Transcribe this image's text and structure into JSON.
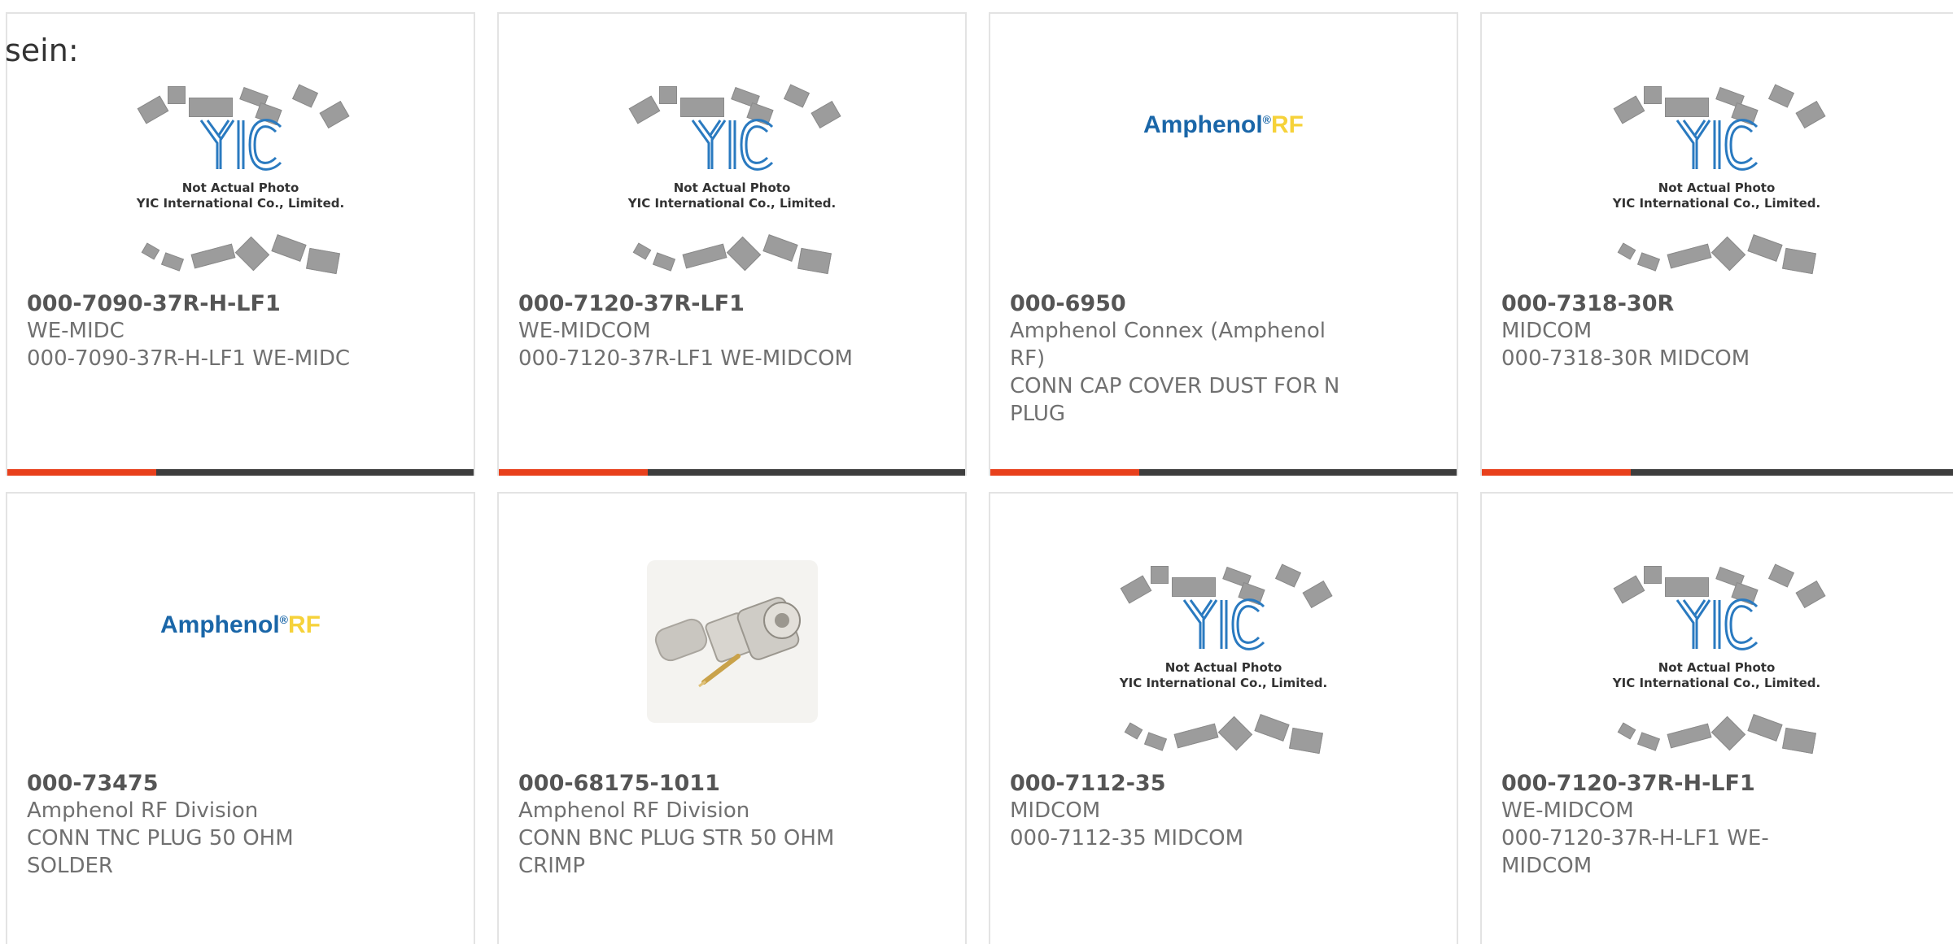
{
  "stray_text": "sein:",
  "placeholder": {
    "logo_text": "YIC",
    "caption_line1": "Not Actual Photo",
    "caption_line2": "YIC International Co., Limited."
  },
  "amphenol_logo": {
    "brand": "Amphenol",
    "registered": "®",
    "suffix": "RF"
  },
  "colors": {
    "accent": "#e8401c",
    "bar": "#3d3d3d",
    "card_border": "#e3e3e3"
  },
  "products": [
    {
      "part_number": "000-7090-37R-H-LF1",
      "manufacturer": "WE-MIDC",
      "description": "000-7090-37R-H-LF1 WE-MIDC",
      "image": "yic-placeholder"
    },
    {
      "part_number": "000-7120-37R-LF1",
      "manufacturer": "WE-MIDCOM",
      "description": "000-7120-37R-LF1 WE-MIDCOM",
      "image": "yic-placeholder"
    },
    {
      "part_number": "000-6950",
      "manufacturer": "Amphenol Connex (Amphenol RF)",
      "description": "CONN CAP COVER DUST FOR N PLUG",
      "image": "amphenol-logo"
    },
    {
      "part_number": "000-7318-30R",
      "manufacturer": "MIDCOM",
      "description": "000-7318-30R MIDCOM",
      "image": "yic-placeholder"
    },
    {
      "part_number": "000-73475",
      "manufacturer": "Amphenol RF Division",
      "description": "CONN TNC PLUG 50 OHM SOLDER",
      "image": "amphenol-logo"
    },
    {
      "part_number": "000-68175-1011",
      "manufacturer": "Amphenol RF Division",
      "description": "CONN BNC PLUG STR 50 OHM CRIMP",
      "image": "connector-photo"
    },
    {
      "part_number": "000-7112-35",
      "manufacturer": "MIDCOM",
      "description": "000-7112-35 MIDCOM",
      "image": "yic-placeholder"
    },
    {
      "part_number": "000-7120-37R-H-LF1",
      "manufacturer": "WE-MIDCOM",
      "description": "000-7120-37R-H-LF1 WE-MIDCOM",
      "image": "yic-placeholder"
    }
  ]
}
